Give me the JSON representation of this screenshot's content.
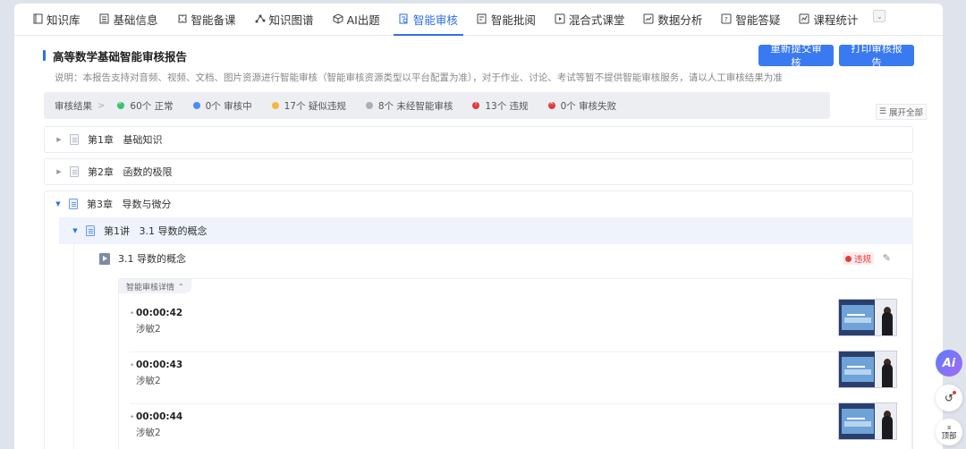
{
  "nav": {
    "tabs": [
      {
        "label": "知识库",
        "icon": "book-icon"
      },
      {
        "label": "基础信息",
        "icon": "list-icon"
      },
      {
        "label": "智能备课",
        "icon": "puzzle-icon"
      },
      {
        "label": "知识图谱",
        "icon": "graph-icon"
      },
      {
        "label": "AI出题",
        "icon": "cube-icon"
      },
      {
        "label": "智能审核",
        "icon": "audit-icon",
        "active": true
      },
      {
        "label": "智能批阅",
        "icon": "review-icon"
      },
      {
        "label": "混合式课堂",
        "icon": "play-icon"
      },
      {
        "label": "数据分析",
        "icon": "chart-icon"
      },
      {
        "label": "智能答疑",
        "icon": "qa-icon"
      },
      {
        "label": "课程统计",
        "icon": "stats-icon"
      }
    ]
  },
  "header": {
    "title": "高等数学基础智能审核报告",
    "resubmit_label": "重新提交审核",
    "print_label": "打印审核报告",
    "description": "说明：本报告支持对音频、视频、文档、图片资源进行智能审核（智能审核资源类型以平台配置为准），对于作业、讨论、考试等暂不提供智能审核服务，请以人工审核结果为准"
  },
  "stats": {
    "label": "审核结果",
    "items": [
      {
        "text": "60个 正常",
        "color": "#3cc36b"
      },
      {
        "text": "0个 审核中",
        "color": "#4b8df5"
      },
      {
        "text": "17个 疑似违规",
        "color": "#f5b942"
      },
      {
        "text": "8个 未经智能审核",
        "color": "#a9afb9"
      },
      {
        "text": "13个 违规",
        "color": "#e23b3b"
      },
      {
        "text": "0个 审核失败",
        "color": "#e23b3b"
      }
    ],
    "expand_all": "展开全部"
  },
  "chapters": [
    {
      "label": "第1章   基础知识"
    },
    {
      "label": "第2章   函数的极限"
    },
    {
      "label": "第3章   导数与微分"
    }
  ],
  "lecture": {
    "label": "第1讲   3.1 导数的概念"
  },
  "resource": {
    "title": "3.1 导数的概念",
    "status": "违规",
    "detail_tag": "智能审核详情",
    "entries": [
      {
        "time": "00:00:42",
        "label": "涉敏2"
      },
      {
        "time": "00:00:43",
        "label": "涉敏2"
      },
      {
        "time": "00:00:44",
        "label": "涉敏2"
      }
    ]
  },
  "floating": {
    "ai": "Ai",
    "top": "顶部"
  }
}
